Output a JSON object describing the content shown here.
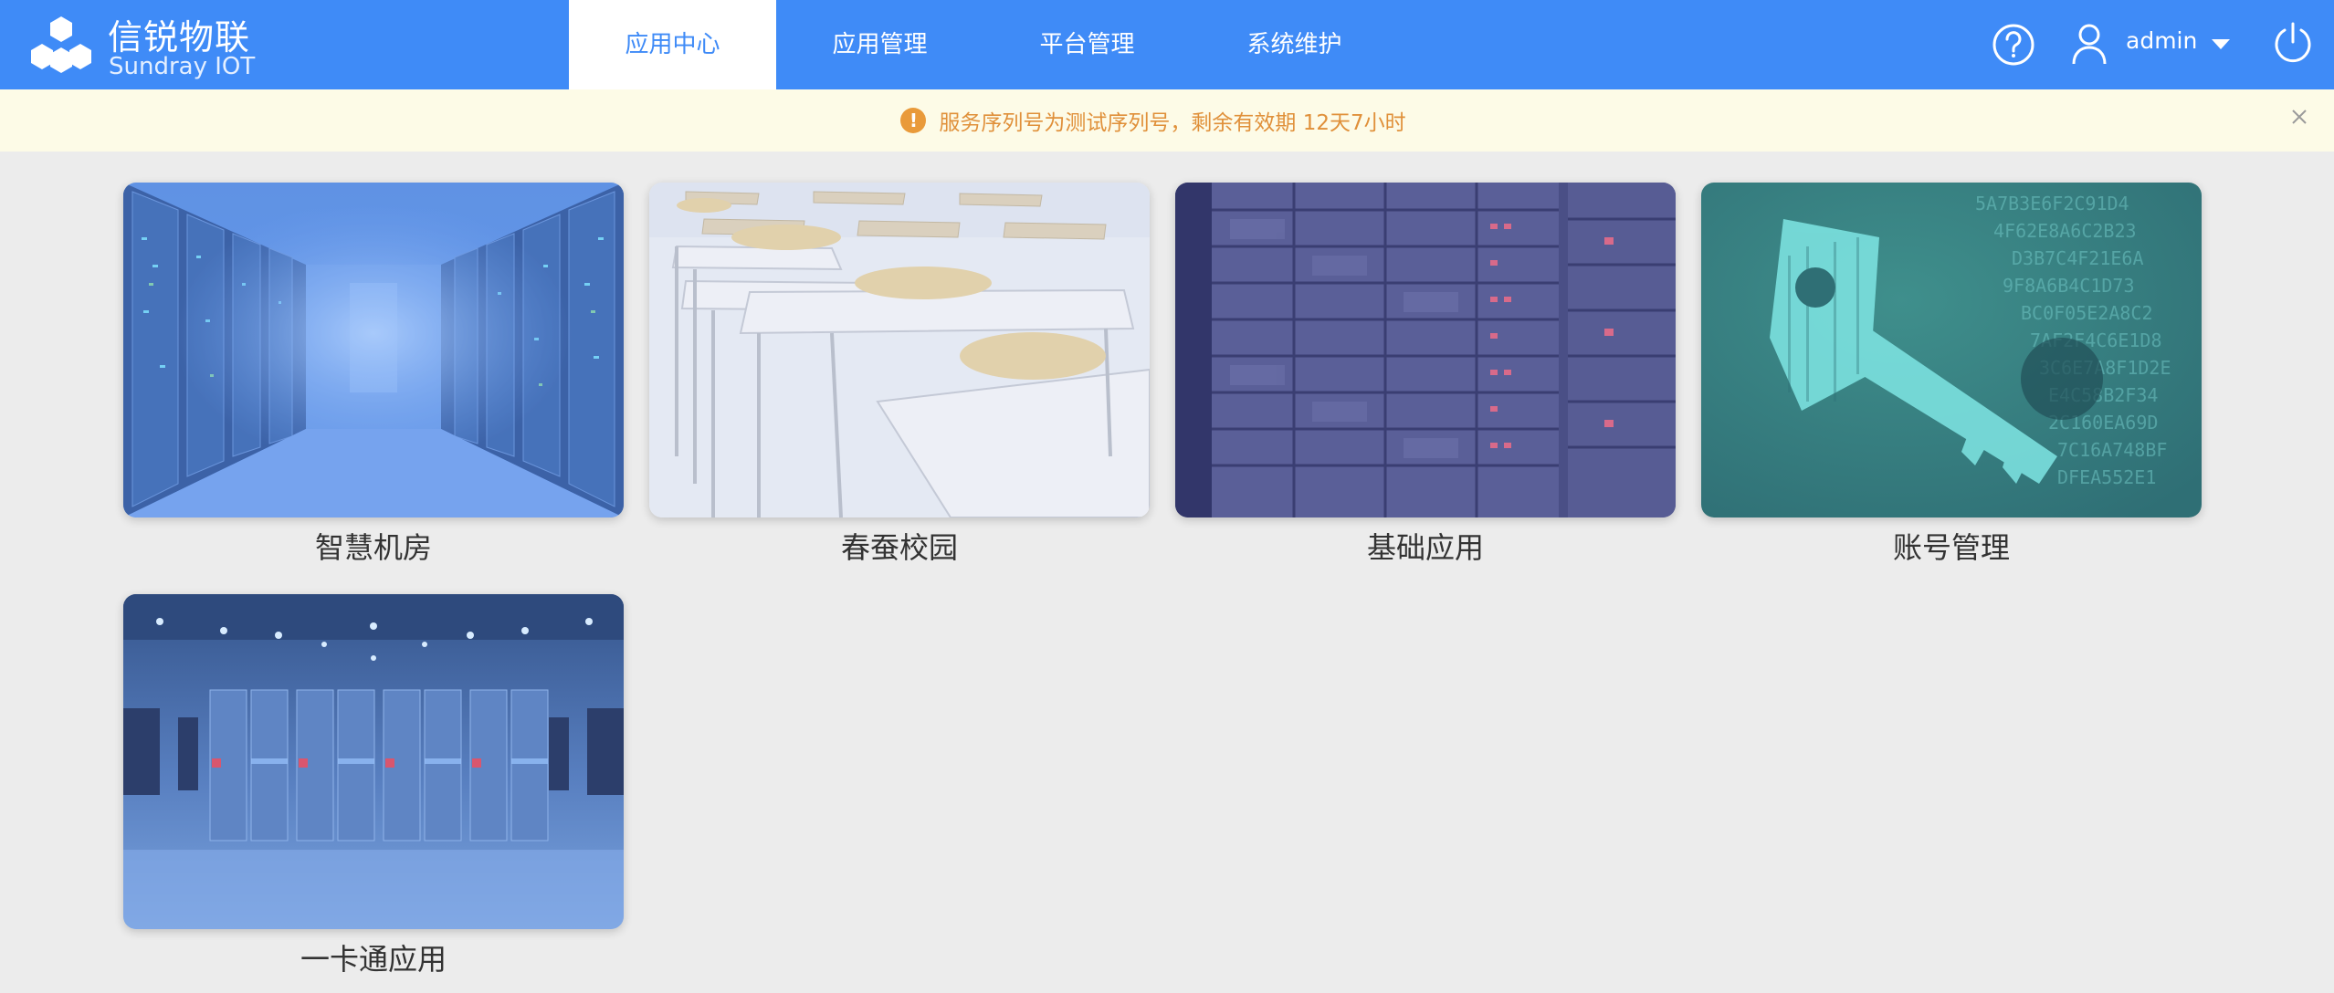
{
  "brand": {
    "title": "信锐物联",
    "subtitle": "Sundray IOT",
    "color": "#3f8bf7"
  },
  "nav": {
    "tabs": [
      {
        "label": "应用中心",
        "active": true
      },
      {
        "label": "应用管理",
        "active": false
      },
      {
        "label": "平台管理",
        "active": false
      },
      {
        "label": "系统维护",
        "active": false
      }
    ]
  },
  "user": {
    "name": "admin",
    "icons": [
      "help-icon",
      "user-icon",
      "caret-down-icon",
      "power-icon"
    ]
  },
  "notice": {
    "text": "服务序列号为测试序列号，剩余有效期 12天7小时",
    "color": "#e0903a",
    "icon": "warning-icon"
  },
  "apps": [
    {
      "label": "智慧机房"
    },
    {
      "label": "春蚕校园"
    },
    {
      "label": "基础应用"
    },
    {
      "label": "账号管理"
    },
    {
      "label": "一卡通应用"
    }
  ]
}
